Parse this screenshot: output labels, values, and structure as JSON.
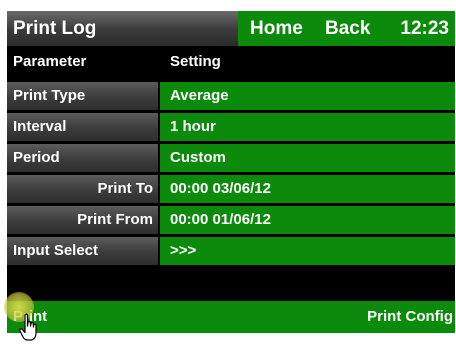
{
  "header": {
    "title": "Print Log",
    "home_label": "Home",
    "back_label": "Back",
    "time": "12:23"
  },
  "table": {
    "col_parameter": "Parameter",
    "col_setting": "Setting",
    "rows": [
      {
        "label": "Print Type",
        "value": "Average"
      },
      {
        "label": "Interval",
        "value": "1 hour"
      },
      {
        "label": "Period",
        "value": "Custom"
      },
      {
        "label": "Print To",
        "value": "00:00  03/06/12"
      },
      {
        "label": "Print From",
        "value": "00:00  01/06/12"
      },
      {
        "label": "Input Select",
        "value": ">>>"
      }
    ]
  },
  "footer": {
    "print_label": "Print",
    "config_label": "Print Config"
  },
  "colors": {
    "accent_green": "#0b8a0b",
    "label_gray": "#3c3c3c",
    "background": "#000000",
    "text": "#ffffff"
  },
  "icons": {
    "cursor": "hand-pointer-icon"
  }
}
